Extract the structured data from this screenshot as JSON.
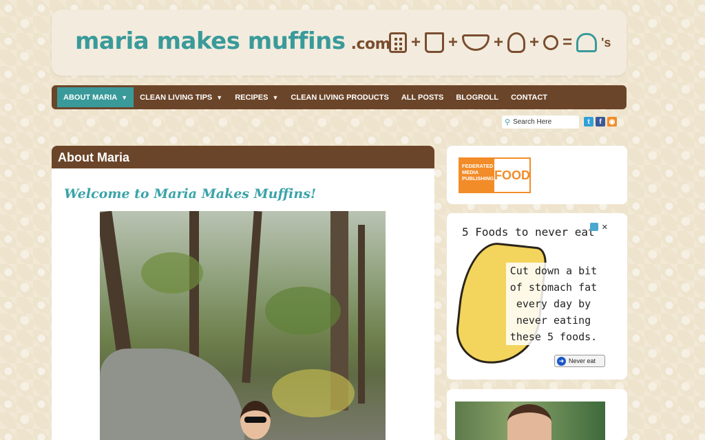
{
  "header": {
    "logo_text": "maria makes muffins",
    "logo_tld": ".com",
    "equation_tail": "'s"
  },
  "nav": {
    "items": [
      {
        "label": "ABOUT MARIA",
        "dropdown": true,
        "active": true
      },
      {
        "label": "CLEAN LIVING TIPS",
        "dropdown": true
      },
      {
        "label": "RECIPES",
        "dropdown": true
      },
      {
        "label": "CLEAN LIVING PRODUCTS",
        "dropdown": false
      },
      {
        "label": "ALL POSTS",
        "dropdown": false
      },
      {
        "label": "BLOGROLL",
        "dropdown": false
      },
      {
        "label": "CONTACT",
        "dropdown": false
      }
    ]
  },
  "search": {
    "placeholder": "Search Here"
  },
  "social": [
    {
      "name": "twitter-icon",
      "glyph": "t",
      "color": "#33a0d8"
    },
    {
      "name": "facebook-icon",
      "glyph": "f",
      "color": "#3b5998"
    },
    {
      "name": "rss-icon",
      "glyph": "◉",
      "color": "#f28c28"
    }
  ],
  "content": {
    "title": "About Maria",
    "welcome": "Welcome to Maria Makes Muffins!"
  },
  "sidebar": {
    "fmp_left": "FEDERATED MEDIA PUBLISHING",
    "fmp_right": "FOOD",
    "ad_title": "5 Foods to never eat",
    "ad_text": "Cut down a bit of stomach fat every day by never eating these 5 foods.",
    "ad_cta": "Never eat",
    "ad_close": "✕"
  },
  "colors": {
    "teal": "#3a9a9a",
    "brown": "#6b4529",
    "orange": "#f28c28"
  }
}
